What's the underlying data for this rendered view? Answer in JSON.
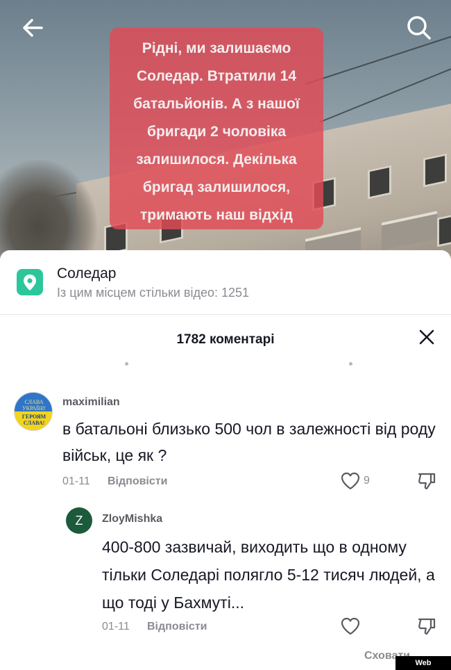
{
  "video": {
    "caption_lines": [
      "Рідні, ми залишаємо",
      "Соледар. Втратили 14",
      "батальйонів. А з нашої",
      "бригади 2 чоловіка",
      "залишилося. Декілька",
      "бригад залишилося,",
      "тримають наш відхід"
    ],
    "caption_bg": "#e24a56",
    "back_icon": "arrow-left-icon",
    "search_icon": "search-icon"
  },
  "location": {
    "title": "Соледар",
    "subtitle": "Із цим місцем стільки відео: 1251",
    "icon": "location-pin-icon",
    "icon_color": "#2cc69b"
  },
  "comments": {
    "header": "1782 коментарі",
    "close_icon": "close-icon",
    "items": [
      {
        "username": "maximilian",
        "avatar_top": "СЛАВА УКРАЇНІ!",
        "avatar_bottom": "ГЕРОЯМ СЛАВА!",
        "text": "в батальоні близько 500 чол в залежності від роду військ, це як ?",
        "date": "01-11",
        "reply_label": "Відповісти",
        "likes": "9"
      },
      {
        "username": "ZloyMishka",
        "avatar_letter": "Z",
        "avatar_color": "#1c5a3c",
        "text": "400-800 зазвичай, виходить що в одному тільки Соледарі полягло 5-12 тисяч людей, а що тоді у Бахмуті...",
        "date": "01-11",
        "reply_label": "Відповісти"
      }
    ],
    "hide_label": "Сховати"
  },
  "watermark": "Web Screenshot"
}
